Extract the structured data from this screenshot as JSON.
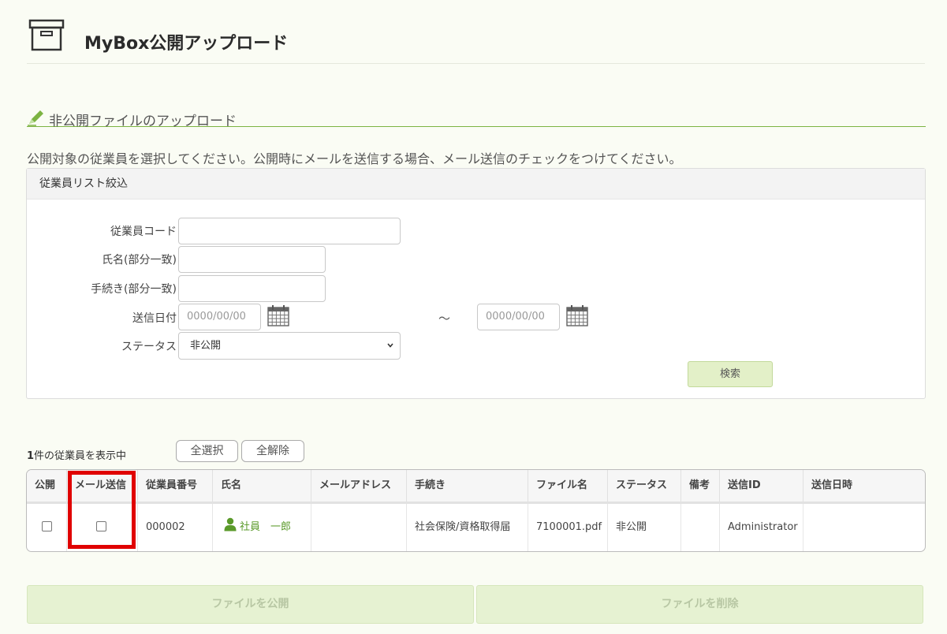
{
  "header": {
    "title": "MyBox公開アップロード",
    "icon": "archive-box-icon"
  },
  "section": {
    "title": "非公開ファイルのアップロード",
    "icon": "pencil-icon"
  },
  "instructions": "公開対象の従業員を選択してください。公開時にメールを送信する場合、メール送信のチェックをつけてください。",
  "filter": {
    "heading": "従業員リスト絞込",
    "employee_code_label": "従業員コード",
    "employee_code_value": "",
    "name_label": "氏名(部分一致)",
    "name_value": "",
    "procedure_label": "手続き(部分一致)",
    "procedure_value": "",
    "send_date_label": "送信日付",
    "date_from_placeholder": "0000/00/00",
    "date_to_placeholder": "0000/00/00",
    "range_separator": "～",
    "status_label": "ステータス",
    "status_selected": "非公開",
    "search_label": "検索"
  },
  "list": {
    "count_number": "1",
    "count_suffix": "件の従業員を表示中",
    "select_all_label": "全選択",
    "clear_all_label": "全解除"
  },
  "table": {
    "columns": [
      "公開",
      "メール送信",
      "従業員番号",
      "氏名",
      "メールアドレス",
      "手続き",
      "ファイル名",
      "ステータス",
      "備考",
      "送信ID",
      "送信日時"
    ],
    "rows": [
      {
        "publish": false,
        "send_mail": false,
        "employee_no": "000002",
        "name": "社員　一郎",
        "email": "",
        "procedure": "社会保険/資格取得届",
        "file_name": "7100001.pdf",
        "status": "非公開",
        "note": "",
        "send_id": "Administrator",
        "send_datetime": ""
      }
    ]
  },
  "actions": {
    "publish_label": "ファイルを公開",
    "delete_label": "ファイルを削除"
  },
  "colors": {
    "accent_green": "#7cb342",
    "highlight_red": "#e00000",
    "button_green": "#e3f0c8",
    "link_green": "#5a9a2a"
  }
}
